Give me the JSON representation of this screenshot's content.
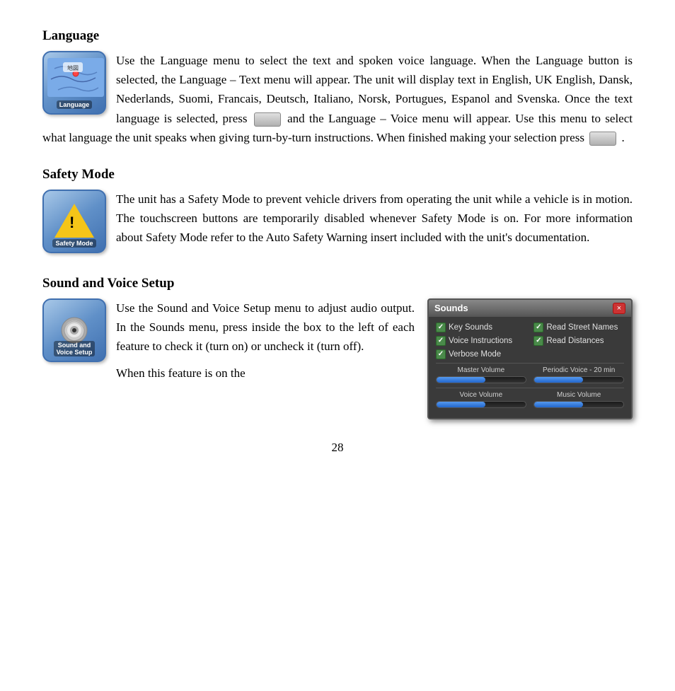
{
  "sections": {
    "language": {
      "title": "Language",
      "icon_label": "Language",
      "body_text": "Use the Language menu to select the text and spoken voice language. When the Language button is selected, the Language – Text menu will appear. The unit will display text in English, UK English, Dansk, Nederlands, Suomi, Francais, Deutsch, Italiano, Norsk, Portugues, Espanol and Svenska. Once the text language is selected, press",
      "body_text2": "and the Language – Voice menu will appear. Use this menu to select what language the unit speaks when giving turn-by-turn instructions. When finished making your selection press",
      "body_text3": "."
    },
    "safety_mode": {
      "title": "Safety Mode",
      "icon_label": "Safety Mode",
      "body_text": "The unit has a Safety Mode to prevent vehicle drivers from operating the unit while a vehicle is in motion. The touchscreen buttons are temporarily disabled whenever Safety Mode is on. For more information about Safety Mode refer to the Auto Safety Warning insert included with the unit's documentation."
    },
    "sound_voice": {
      "title": "Sound and Voice Setup",
      "icon_label1": "Sound and",
      "icon_label2": "Voice Setup",
      "body_text": "Use the Sound and Voice Setup menu to adjust audio output. In the Sounds menu, press inside the box to the left of each feature to check it (turn on) or uncheck it (turn off).",
      "body_text2": "When this feature is on the"
    }
  },
  "sounds_dialog": {
    "title": "Sounds",
    "close_label": "×",
    "items": [
      {
        "label": "Key Sounds",
        "checked": true
      },
      {
        "label": "Read Street Names",
        "checked": true
      },
      {
        "label": "Voice Instructions",
        "checked": true
      },
      {
        "label": "Read Distances",
        "checked": true
      },
      {
        "label": "Verbose Mode",
        "checked": true
      }
    ],
    "sliders": [
      {
        "label": "Master Volume",
        "fill_pct": 55
      },
      {
        "label": "Periodic Voice - 20 min",
        "fill_pct": 55
      },
      {
        "label": "Voice Volume",
        "fill_pct": 55
      },
      {
        "label": "Music Volume",
        "fill_pct": 55
      }
    ]
  },
  "page_number": "28"
}
